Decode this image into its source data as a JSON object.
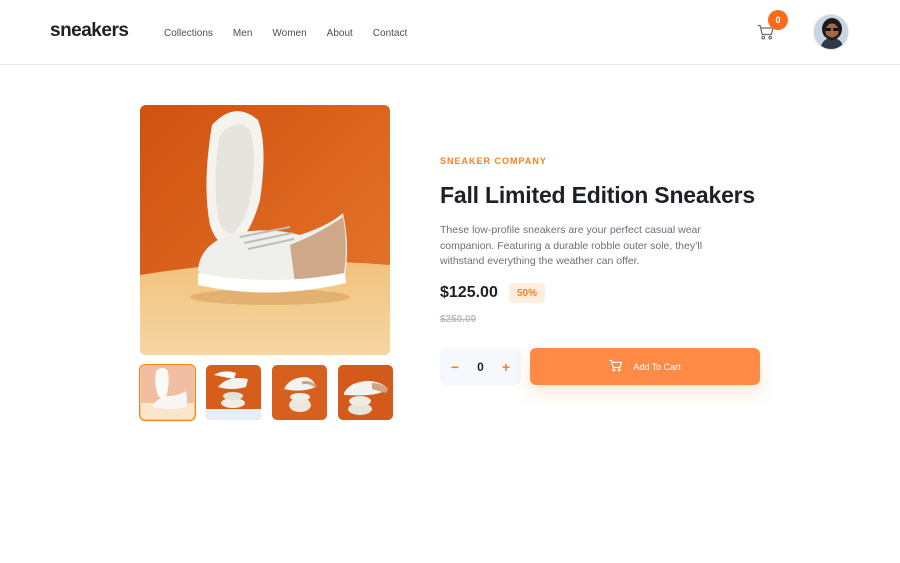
{
  "header": {
    "logo": "sneakers",
    "nav": [
      "Collections",
      "Men",
      "Women",
      "About",
      "Contact"
    ],
    "cart_count": "0",
    "cart_icon": "cart-icon",
    "avatar_icon": "avatar"
  },
  "product": {
    "company": "SNEAKER COMPANY",
    "title": "Fall Limited Edition Sneakers",
    "description": "These low-profile sneakers are your perfect casual wear companion. Featuring a durable robble outer sole, they’ll withstand everything the weather can offer.",
    "price": "$125.00",
    "discount": "50%",
    "old_price": "$250.00",
    "quantity": "0",
    "minus": "−",
    "plus": "+",
    "add_to_cart": "Add To Cart"
  },
  "colors": {
    "accent": "#ff7d1a",
    "dark": "#1d2026",
    "muted": "#68707d"
  }
}
